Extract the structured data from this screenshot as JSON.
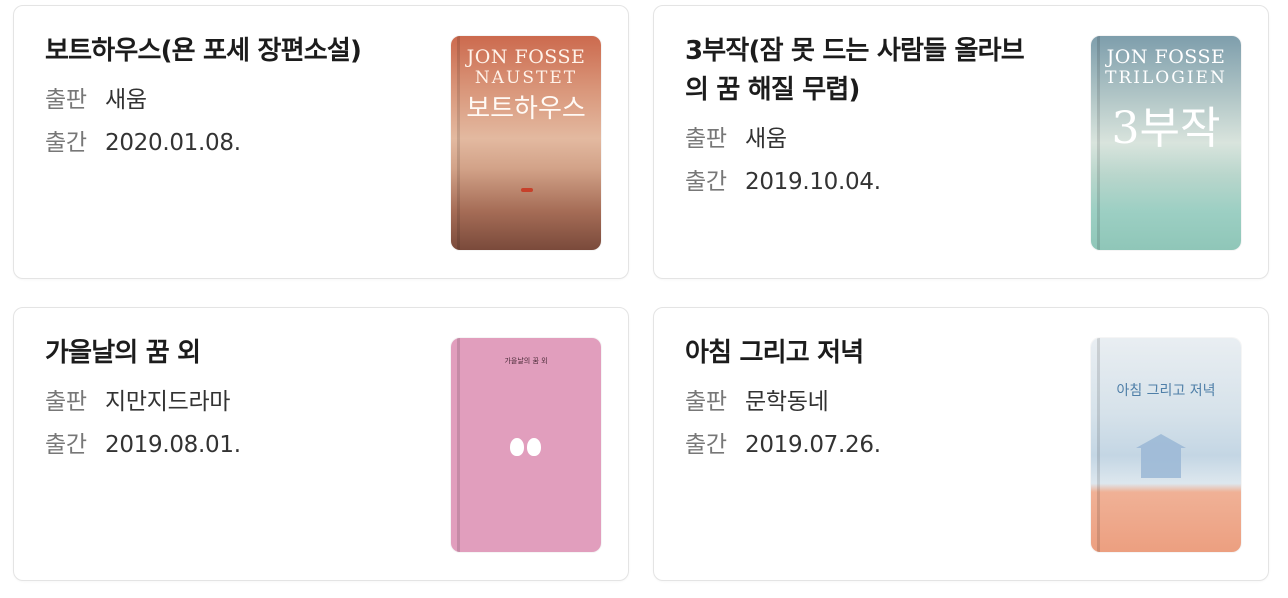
{
  "books": [
    {
      "title": "보트하우스(욘 포세 장편소설)",
      "publisher_label": "출판",
      "publisher": "새움",
      "date_label": "출간",
      "date": "2020.01.08.",
      "cover": {
        "author": "JON FOSSE",
        "original_title": "NAUSTET",
        "korean_title": "보트하우스"
      }
    },
    {
      "title": "3부작(잠 못 드는 사람들 올라브의 꿈 해질 무렵)",
      "publisher_label": "출판",
      "publisher": "새움",
      "date_label": "출간",
      "date": "2019.10.04.",
      "cover": {
        "author": "JON FOSSE",
        "original_title": "TRILOGIEN",
        "korean_title": "3부작"
      }
    },
    {
      "title": "가을날의 꿈 외",
      "publisher_label": "출판",
      "publisher": "지만지드라마",
      "date_label": "출간",
      "date": "2019.08.01.",
      "cover": {
        "korean_title": "가을날의 꿈 외"
      }
    },
    {
      "title": "아침 그리고 저녁",
      "publisher_label": "출판",
      "publisher": "문학동네",
      "date_label": "출간",
      "date": "2019.07.26.",
      "cover": {
        "korean_title": "아침 그리고 저녁"
      }
    }
  ]
}
